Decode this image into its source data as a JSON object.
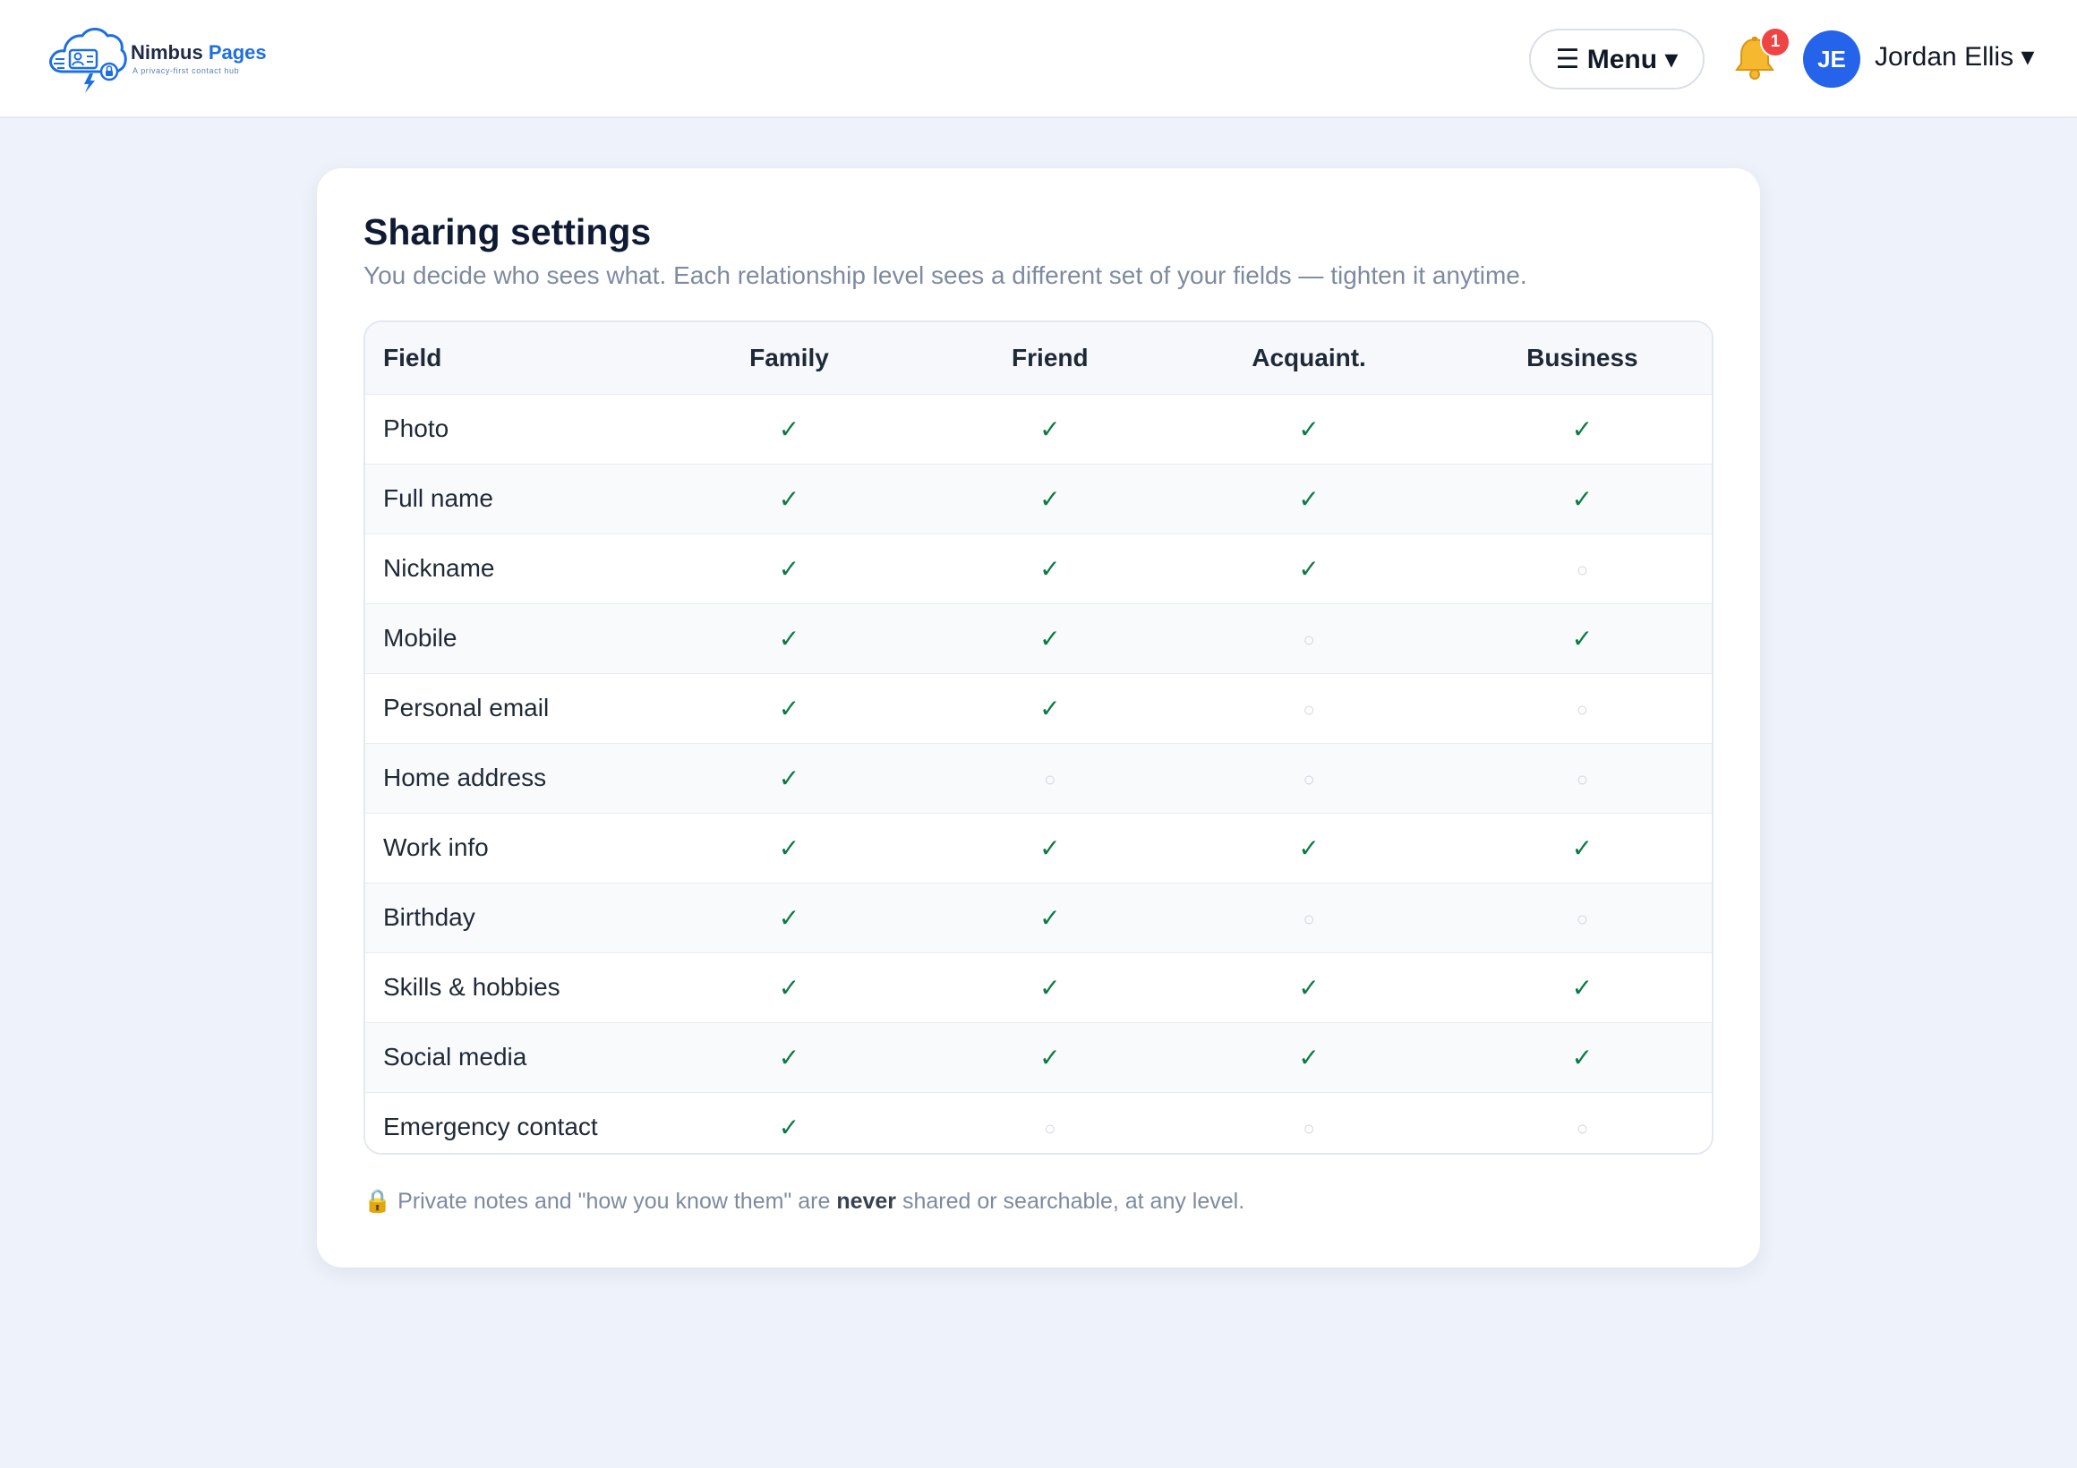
{
  "brand": {
    "name_part1": "Nimbus",
    "name_part2": "Pages",
    "tagline": "A privacy-first contact hub"
  },
  "header": {
    "menu_label": "☰ Menu ▾",
    "notification_count": "1",
    "avatar_initials": "JE",
    "user_name": "Jordan Ellis ▾"
  },
  "card": {
    "title": "Sharing settings",
    "subtitle": "You decide who sees what. Each relationship level sees a different set of your fields — tighten it anytime."
  },
  "table": {
    "columns": [
      "Field",
      "Family",
      "Friend",
      "Acquaint.",
      "Business"
    ],
    "rows": [
      {
        "field": "Photo",
        "values": [
          true,
          true,
          true,
          true
        ]
      },
      {
        "field": "Full name",
        "values": [
          true,
          true,
          true,
          true
        ]
      },
      {
        "field": "Nickname",
        "values": [
          true,
          true,
          true,
          false
        ]
      },
      {
        "field": "Mobile",
        "values": [
          true,
          true,
          false,
          true
        ]
      },
      {
        "field": "Personal email",
        "values": [
          true,
          true,
          false,
          false
        ]
      },
      {
        "field": "Home address",
        "values": [
          true,
          false,
          false,
          false
        ]
      },
      {
        "field": "Work info",
        "values": [
          true,
          true,
          true,
          true
        ]
      },
      {
        "field": "Birthday",
        "values": [
          true,
          true,
          false,
          false
        ]
      },
      {
        "field": "Skills & hobbies",
        "values": [
          true,
          true,
          true,
          true
        ]
      },
      {
        "field": "Social media",
        "values": [
          true,
          true,
          true,
          true
        ]
      },
      {
        "field": "Emergency contact",
        "values": [
          true,
          false,
          false,
          false
        ]
      }
    ],
    "shared_glyph": "✓",
    "not_shared_glyph": "○"
  },
  "footnote": {
    "icon": "🔒",
    "before": " Private notes and \"how you know them\" are ",
    "emphasis": "never",
    "after": " shared or searchable, at any level."
  },
  "colors": {
    "accent": "#2563eb",
    "check": "#0b7a45",
    "badge": "#ef4444",
    "page_bg": "#eef2fa"
  }
}
